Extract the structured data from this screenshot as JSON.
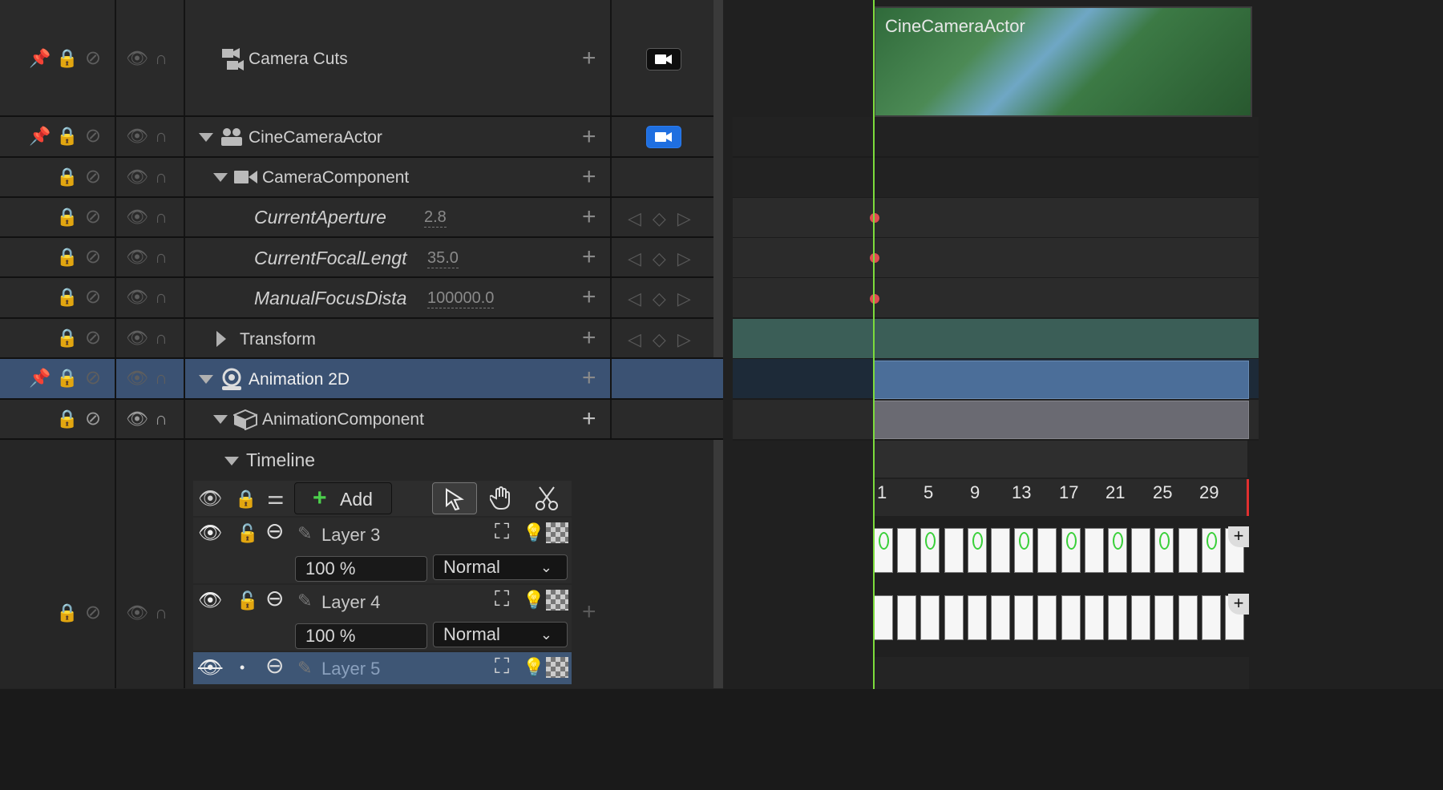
{
  "tracks": {
    "camera_cuts": "Camera Cuts",
    "cine_camera_actor": "CineCameraActor",
    "camera_component": "CameraComponent",
    "current_aperture": "CurrentAperture",
    "current_aperture_value": "2.8",
    "current_focal_length": "CurrentFocalLengt",
    "current_focal_length_value": "35.0",
    "manual_focus_distance": "ManualFocusDista",
    "manual_focus_distance_value": "100000.0",
    "transform": "Transform",
    "animation_2d": "Animation 2D",
    "animation_component": "AnimationComponent",
    "timeline": "Timeline"
  },
  "timeline_panel": {
    "add_label": "Add",
    "layers": [
      {
        "name": "Layer 3",
        "opacity": "100 %",
        "blend": "Normal"
      },
      {
        "name": "Layer 4",
        "opacity": "100 %",
        "blend": "Normal"
      },
      {
        "name": "Layer 5"
      }
    ]
  },
  "sequencer": {
    "clip_label": "CineCameraActor",
    "frame_numbers": [
      "1",
      "5",
      "9",
      "13",
      "17",
      "21",
      "25",
      "29"
    ]
  },
  "colors": {
    "accent_blue": "#1f6fe0",
    "selection": "#3b5273",
    "playhead": "#7cdc3c",
    "key_dot": "#e05050"
  }
}
